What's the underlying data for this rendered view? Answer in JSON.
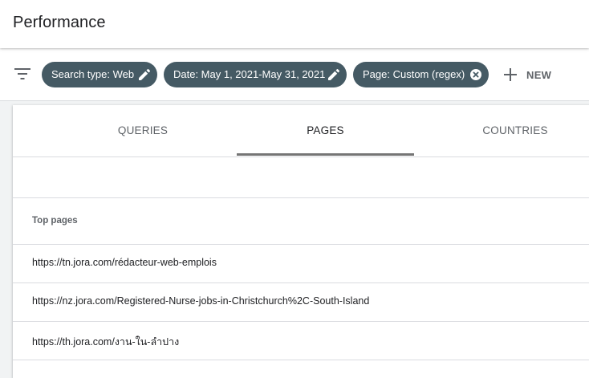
{
  "header": {
    "title": "Performance"
  },
  "filters": {
    "icon": "filter-list-icon",
    "chips": [
      {
        "label": "Search type: Web",
        "icon": "edit-pencil-icon"
      },
      {
        "label": "Date: May 1, 2021-May 31, 2021",
        "icon": "edit-pencil-icon"
      },
      {
        "label": "Page: Custom (regex)",
        "icon": "clear-circle-icon"
      }
    ],
    "new_label": "NEW",
    "chip_color": "#455a64"
  },
  "tabs": [
    {
      "label": "QUERIES",
      "active": false
    },
    {
      "label": "PAGES",
      "active": true
    },
    {
      "label": "COUNTRIES",
      "active": false
    }
  ],
  "table": {
    "column_header": "Top pages",
    "rows": [
      {
        "url": "https://tn.jora.com/rédacteur-web-emplois"
      },
      {
        "url": "https://nz.jora.com/Registered-Nurse-jobs-in-Christchurch%2C-South-Island"
      },
      {
        "url": "https://th.jora.com/งาน-ใน-ลำปาง"
      }
    ]
  }
}
